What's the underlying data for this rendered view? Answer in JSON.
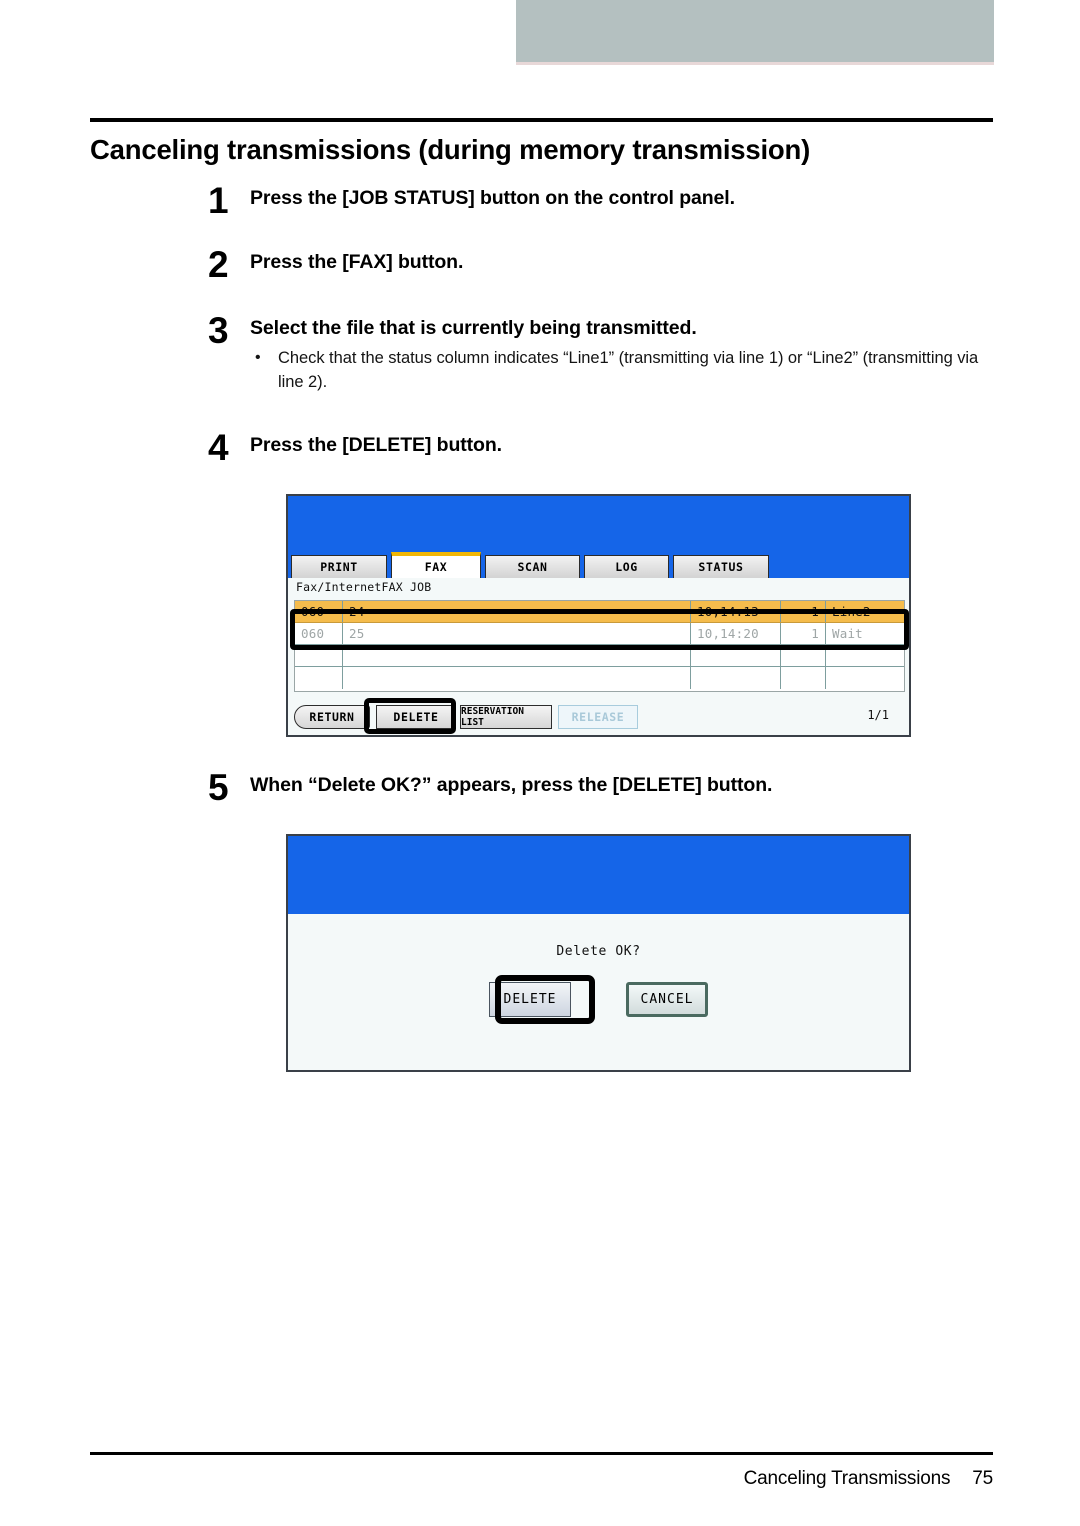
{
  "page": {
    "title": "Canceling transmissions (during memory transmission)",
    "footer_section": "Canceling Transmissions",
    "footer_page_number": "75"
  },
  "colors": {
    "lcd_blue": "#1565e8",
    "selected_row_orange": "#f5bc4c",
    "active_tab_accent": "#f2b705",
    "top_bar_gray": "#b4c0c0"
  },
  "steps": [
    {
      "number": "1",
      "title": "Press the [JOB STATUS] button on the control panel.",
      "bullets": []
    },
    {
      "number": "2",
      "title": "Press the [FAX] button.",
      "bullets": []
    },
    {
      "number": "3",
      "title": "Select the file that is currently being transmitted.",
      "bullets": [
        "Check that the status column indicates “Line1” (transmitting via line 1) or “Line2” (transmitting via line 2)."
      ]
    },
    {
      "number": "4",
      "title": "Press the [DELETE] button.",
      "bullets": []
    },
    {
      "number": "5",
      "title": "When “Delete OK?” appears, press the [DELETE] button.",
      "bullets": []
    }
  ],
  "job_screen": {
    "tabs": [
      {
        "label": "PRINT",
        "active": false
      },
      {
        "label": "FAX",
        "active": true
      },
      {
        "label": "SCAN",
        "active": false
      },
      {
        "label": "LOG",
        "active": false
      },
      {
        "label": "STATUS",
        "active": false
      }
    ],
    "job_list_label": "Fax/InternetFAX JOB",
    "rows": [
      {
        "id": "060",
        "name": "24",
        "time": "10,14:13",
        "pages": "1",
        "status": "Line2",
        "selected": true
      },
      {
        "id": "060",
        "name": "25",
        "time": "10,14:20",
        "pages": "1",
        "status": "Wait",
        "selected": false
      }
    ],
    "buttons": {
      "return": "RETURN",
      "delete": "DELETE",
      "reservation_list": "RESERVATION LIST",
      "release": "RELEASE"
    },
    "page_indicator": "1/1"
  },
  "confirm_screen": {
    "message": "Delete OK?",
    "delete_label": "DELETE",
    "cancel_label": "CANCEL"
  }
}
